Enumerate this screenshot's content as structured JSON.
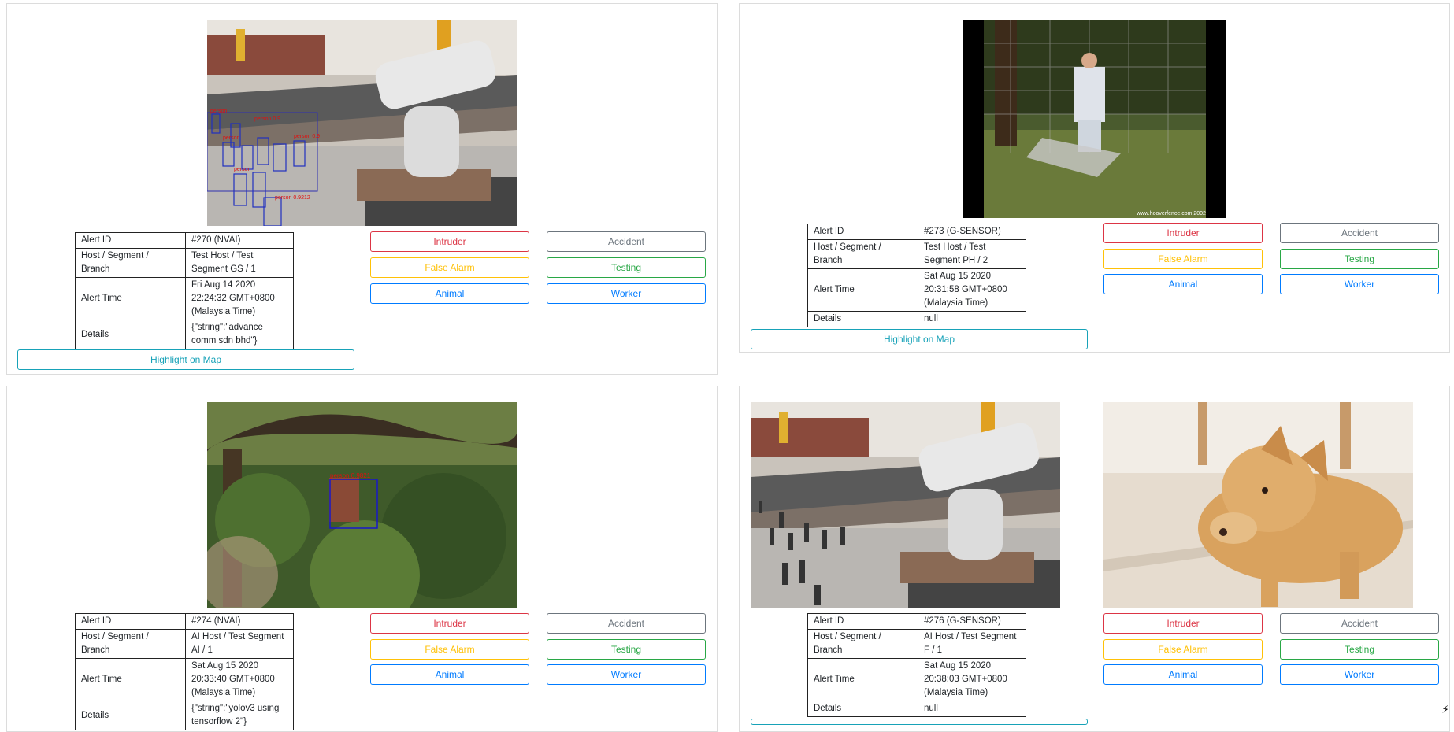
{
  "alerts": [
    {
      "alert_id_label": "Alert ID",
      "alert_id": "#270 (NVAI)",
      "host_label": "Host / Segment / Branch",
      "host": "Test Host / Test Segment GS / 1",
      "time_label": "Alert Time",
      "time": "Fri Aug 14 2020 22:24:32 GMT+0800 (Malaysia Time)",
      "details_label": "Details",
      "details": "{\"string\":\"advance comm sdn bhd\"}",
      "highlight": "Highlight on Map",
      "image_overlay_text": "person 0.9212"
    },
    {
      "alert_id_label": "Alert ID",
      "alert_id": "#273 (G-SENSOR)",
      "host_label": "Host / Segment / Branch",
      "host": "Test Host / Test Segment PH / 2",
      "time_label": "Alert Time",
      "time": "Sat Aug 15 2020 20:31:58 GMT+0800 (Malaysia Time)",
      "details_label": "Details",
      "details": "null",
      "highlight": "Highlight on Map",
      "image_overlay_text": "www.hooverfence.com 2002"
    },
    {
      "alert_id_label": "Alert ID",
      "alert_id": "#274 (NVAI)",
      "host_label": "Host / Segment / Branch",
      "host": "AI Host / Test Segment AI / 1",
      "time_label": "Alert Time",
      "time": "Sat Aug 15 2020 20:33:40 GMT+0800 (Malaysia Time)",
      "details_label": "Details",
      "details": "{\"string\":\"yolov3 using tensorflow 2\"}",
      "image_overlay_text": "person 0.9821"
    },
    {
      "alert_id_label": "Alert ID",
      "alert_id": "#276 (G-SENSOR)",
      "host_label": "Host / Segment / Branch",
      "host": "AI Host / Test Segment F / 1",
      "time_label": "Alert Time",
      "time": "Sat Aug 15 2020 20:38:03 GMT+0800 (Malaysia Time)",
      "details_label": "Details",
      "details": "null"
    }
  ],
  "buttons": {
    "intruder": "Intruder",
    "accident": "Accident",
    "false_alarm": "False Alarm",
    "testing": "Testing",
    "animal": "Animal",
    "worker": "Worker"
  },
  "colors": {
    "intruder": "#dc3545",
    "accident": "#6c757d",
    "false_alarm": "#ffc107",
    "testing": "#28a745",
    "animal": "#007bff",
    "highlight": "#17a2b8"
  },
  "corner_icon": "bolt-icon"
}
